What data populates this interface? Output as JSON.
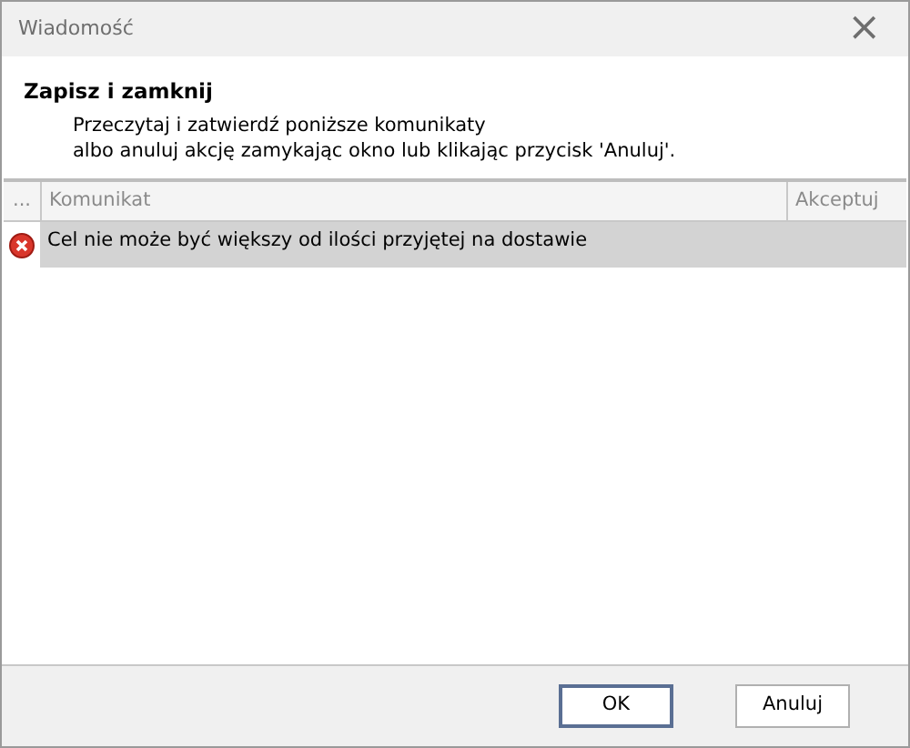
{
  "window": {
    "title": "Wiadomość",
    "close": "×"
  },
  "heading": "Zapisz i zamknij",
  "instructions": [
    "Przeczytaj i zatwierdź poniższe komunikaty",
    "albo anuluj akcję zamykając okno lub klikając przycisk 'Anuluj'."
  ],
  "table": {
    "columns": [
      "...",
      "Komunikat",
      "Akceptuj"
    ],
    "rows": [
      {
        "kind": "error",
        "message": "Cel nie może być większy od ilości przyjętej na dostawie",
        "selected": true
      }
    ]
  },
  "buttons": [
    {
      "label": "OK",
      "default": true
    },
    {
      "label": "Anuluj",
      "default": false
    }
  ]
}
